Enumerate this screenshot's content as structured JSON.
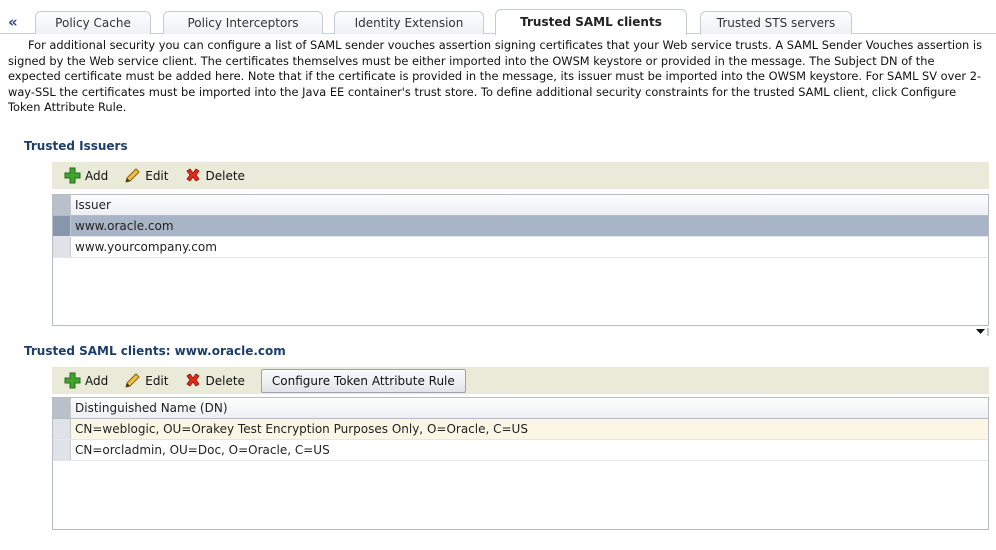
{
  "tabs": {
    "collapse_glyph": "«",
    "items": [
      {
        "label": "Policy Cache"
      },
      {
        "label": "Policy Interceptors"
      },
      {
        "label": "Identity Extension"
      },
      {
        "label": "Trusted SAML clients"
      },
      {
        "label": "Trusted STS servers"
      }
    ],
    "selected": "Trusted SAML clients"
  },
  "description": "For additional security you can configure a list of SAML sender vouches assertion signing certificates that your Web service trusts. A SAML Sender Vouches assertion is signed by the Web service client. The certificates themselves must be either imported into the OWSM keystore or provided in the message. The Subject DN of the expected certificate must be added here. Note that if the certificate is provided in the message, its issuer must be imported into the OWSM keystore. For SAML SV over 2-way-SSL the certificates must be imported into the Java EE container's trust store. To define additional security constraints for the trusted SAML client, click Configure Token Attribute Rule.",
  "issuers": {
    "title": "Trusted Issuers",
    "toolbar": {
      "add": "Add",
      "edit": "Edit",
      "delete": "Delete"
    },
    "column": "Issuer",
    "rows": [
      "www.oracle.com",
      "www.yourcompany.com"
    ],
    "selected_row": "www.oracle.com"
  },
  "clients": {
    "title": "Trusted SAML clients: www.oracle.com",
    "toolbar": {
      "add": "Add",
      "edit": "Edit",
      "delete": "Delete",
      "configure": "Configure Token Attribute Rule"
    },
    "column": "Distinguished Name (DN)",
    "rows": [
      "CN=weblogic, OU=Orakey Test Encryption Purposes Only, O=Oracle, C=US",
      "CN=orcladmin, OU=Doc, O=Oracle, C=US"
    ]
  },
  "icons": {
    "collapse": "double-chevron-left-icon",
    "add": "green-plus-icon",
    "edit": "pencil-icon",
    "delete": "red-x-icon",
    "scroll": "down-arrow-icon"
  },
  "colors": {
    "section_title": "#1d3e6b",
    "toolbar_bg": "#e9ebd8",
    "selected_row": "#a8b5c7",
    "hover_row": "#fbf7e4"
  }
}
